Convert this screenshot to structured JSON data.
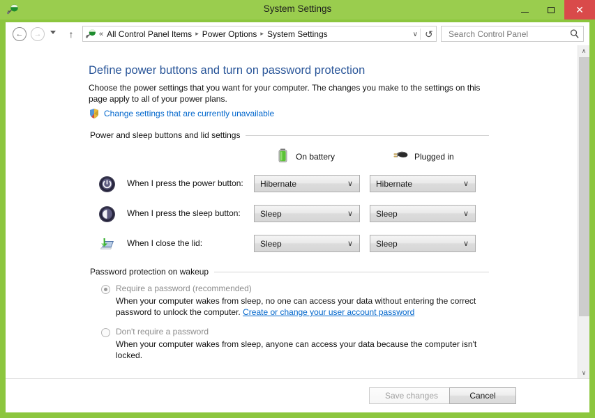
{
  "window": {
    "title": "System Settings",
    "icon": "power-plug-icon",
    "controls": {
      "minimize": "–",
      "maximize": "□",
      "close": "✕"
    }
  },
  "nav": {
    "back_icon": "back-arrow-icon",
    "forward_icon": "forward-arrow-icon",
    "recent_icon": "chevron-down-icon",
    "up_icon": "up-arrow-icon",
    "back_glyph": "←",
    "forward_glyph": "→",
    "up_glyph": "↑",
    "address_icon": "power-plug-icon",
    "overflow_glyph": "«",
    "breadcrumbs": [
      "All Control Panel Items",
      "Power Options",
      "System Settings"
    ],
    "separator": "▸",
    "dropdown_glyph": "∨",
    "refresh_glyph": "↻"
  },
  "search": {
    "placeholder": "Search Control Panel",
    "value": "",
    "icon": "search-icon"
  },
  "page": {
    "title": "Define power buttons and turn on password protection",
    "description": "Choose the power settings that you want for your computer. The changes you make to the settings on this page apply to all of your power plans.",
    "uac_link": "Change settings that are currently unavailable",
    "uac_icon": "shield-icon"
  },
  "power_group": {
    "header": "Power and sleep buttons and lid settings",
    "columns": [
      {
        "label": "On battery",
        "icon": "battery-icon"
      },
      {
        "label": "Plugged in",
        "icon": "power-plug-icon"
      }
    ],
    "rows": [
      {
        "icon": "power-button-icon",
        "label": "When I press the power button:",
        "on_battery": "Hibernate",
        "plugged_in": "Hibernate"
      },
      {
        "icon": "sleep-button-icon",
        "label": "When I press the sleep button:",
        "on_battery": "Sleep",
        "plugged_in": "Sleep"
      },
      {
        "icon": "laptop-lid-icon",
        "label": "When I close the lid:",
        "on_battery": "Sleep",
        "plugged_in": "Sleep"
      }
    ],
    "caret_glyph": "∨"
  },
  "password_group": {
    "header": "Password protection on wakeup",
    "options": [
      {
        "label": "Require a password (recommended)",
        "selected": true,
        "description_before": "When your computer wakes from sleep, no one can access your data without entering the correct password to unlock the computer. ",
        "link": "Create or change your user account password",
        "description_after": ""
      },
      {
        "label": "Don't require a password",
        "selected": false,
        "description_before": "When your computer wakes from sleep, anyone can access your data because the computer isn't locked.",
        "link": "",
        "description_after": ""
      }
    ]
  },
  "footer": {
    "save_label": "Save changes",
    "save_disabled": true,
    "cancel_label": "Cancel"
  },
  "scrollbar": {
    "up_glyph": "∧",
    "down_glyph": "∨"
  },
  "colors": {
    "frame_green": "#8cc63e",
    "titlebar_green": "#9acd4e",
    "close_red": "#d94a4a",
    "link_blue": "#0066cc",
    "heading_blue": "#2a5699"
  }
}
